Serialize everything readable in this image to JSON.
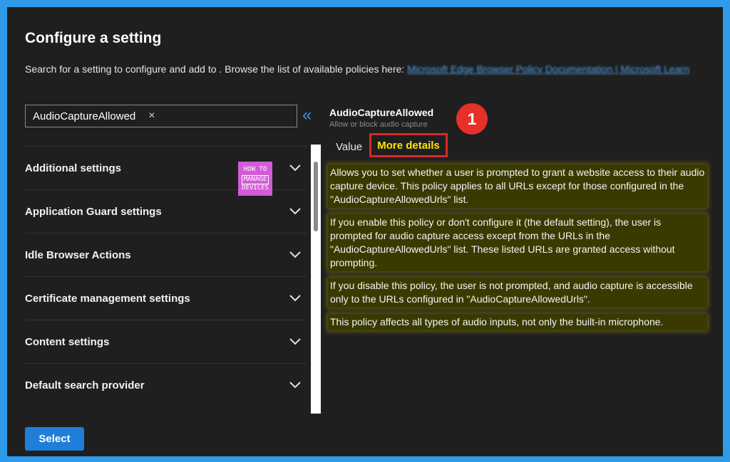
{
  "panel": {
    "title": "Configure a setting",
    "description": "Search for a setting to configure and add to . Browse the list of available policies here:",
    "link": "Microsoft Edge Browser Policy Documentation | Microsoft Learn"
  },
  "search": {
    "value": "AudioCaptureAllowed",
    "clear_icon": "×"
  },
  "collapse_icon": "«",
  "categories": [
    {
      "label": "Additional settings"
    },
    {
      "label": "Application Guard settings"
    },
    {
      "label": "Idle Browser Actions"
    },
    {
      "label": "Certificate management settings"
    },
    {
      "label": "Content settings"
    },
    {
      "label": "Default search provider"
    }
  ],
  "chevron_icon": "⌄",
  "watermark": {
    "line1": "HOW TO",
    "line2": "MANAGE",
    "line3": "DEVICES"
  },
  "setting": {
    "name": "AudioCaptureAllowed",
    "subtitle": "Allow or block audio capture"
  },
  "annotation": {
    "number": "1",
    "color": "#e8302a"
  },
  "tabs": {
    "value": "Value",
    "more_details": "More details"
  },
  "details": [
    "Allows you to set whether a user is prompted to grant a website access to their audio capture device. This policy applies to all URLs except for those configured in the \"AudioCaptureAllowedUrls\" list.",
    "If you enable this policy or don't configure it (the default setting), the user is prompted for audio capture access except from the URLs in the \"AudioCaptureAllowedUrls\" list. These listed URLs are granted access without prompting.",
    "If you disable this policy, the user is not prompted, and audio capture is accessible only to the URLs configured in \"AudioCaptureAllowedUrls\".",
    "This policy affects all types of audio inputs, not only the built-in microphone."
  ],
  "footer": {
    "select_label": "Select"
  },
  "colors": {
    "accent": "#1f7fd8",
    "highlight_text": "#ffe600",
    "annotation_border": "#d82a2a"
  }
}
